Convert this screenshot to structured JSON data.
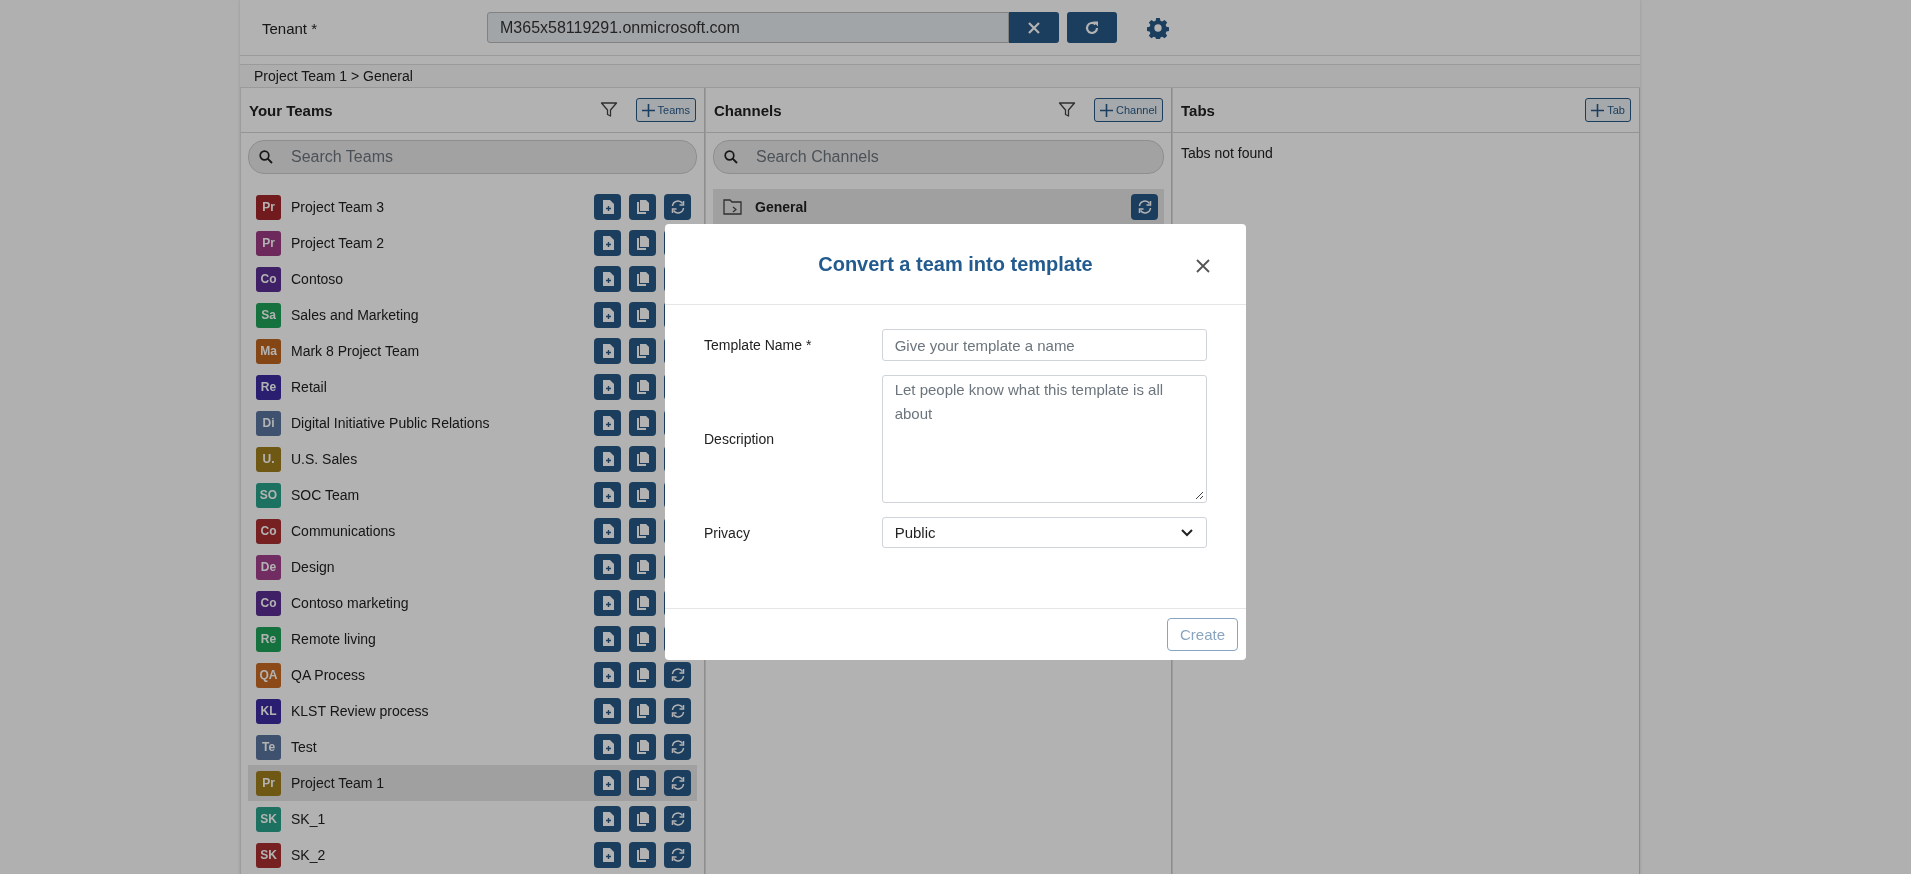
{
  "tenant": {
    "label": "Tenant *",
    "value": "M365x58119291.onmicrosoft.com"
  },
  "breadcrumb": "Project Team 1 > General",
  "teams_panel": {
    "title": "Your Teams",
    "add_button": "Teams",
    "search_placeholder": "Search Teams",
    "items": [
      {
        "initials": "Pr",
        "name": "Project Team 3",
        "color": "#731b1f",
        "selected": false
      },
      {
        "initials": "Pr",
        "name": "Project Team 2",
        "color": "#6d295c",
        "selected": false
      },
      {
        "initials": "Co",
        "name": "Contoso",
        "color": "#402066",
        "selected": false
      },
      {
        "initials": "Sa",
        "name": "Sales and Marketing",
        "color": "#16723f",
        "selected": false
      },
      {
        "initials": "Ma",
        "name": "Mark 8 Project Team",
        "color": "#864716",
        "selected": false
      },
      {
        "initials": "Re",
        "name": "Retail",
        "color": "#291f6f",
        "selected": false
      },
      {
        "initials": "Di",
        "name": "Digital Initiative Public Relations",
        "color": "#3e516f",
        "selected": false
      },
      {
        "initials": "U.",
        "name": "U.S. Sales",
        "color": "#705814",
        "selected": false
      },
      {
        "initials": "SO",
        "name": "SOC Team",
        "color": "#1d7261",
        "selected": false
      },
      {
        "initials": "Co",
        "name": "Communications",
        "color": "#762123",
        "selected": false
      },
      {
        "initials": "De",
        "name": "Design",
        "color": "#722d63",
        "selected": false
      },
      {
        "initials": "Co",
        "name": "Contoso marketing",
        "color": "#402066",
        "selected": false
      },
      {
        "initials": "Re",
        "name": "Remote living",
        "color": "#16723f",
        "selected": false
      },
      {
        "initials": "QA",
        "name": "QA Process",
        "color": "#8b4a18",
        "selected": false
      },
      {
        "initials": "KL",
        "name": "KLST Review process",
        "color": "#291f6f",
        "selected": false
      },
      {
        "initials": "Te",
        "name": "Test",
        "color": "#3e516f",
        "selected": false
      },
      {
        "initials": "Pr",
        "name": "Project Team 1",
        "color": "#705814",
        "selected": true
      },
      {
        "initials": "SK",
        "name": "SK_1",
        "color": "#1d7261",
        "selected": false
      },
      {
        "initials": "SK",
        "name": "SK_2",
        "color": "#762123",
        "selected": false
      }
    ]
  },
  "channels_panel": {
    "title": "Channels",
    "add_button": "Channel",
    "search_placeholder": "Search Channels",
    "items": [
      {
        "name": "General",
        "selected": true
      }
    ]
  },
  "tabs_panel": {
    "title": "Tabs",
    "add_button": "Tab",
    "empty_text": "Tabs not found"
  },
  "dialog": {
    "title": "Convert a team into template",
    "fields": [
      {
        "kind": "text",
        "label": "Template Name *",
        "placeholder": "Give your template a name"
      },
      {
        "kind": "textarea",
        "label": "Description",
        "placeholder": "Let people know what this template is all about"
      },
      {
        "kind": "select",
        "label": "Privacy",
        "value": "Public"
      }
    ],
    "submit_button": {
      "label": "Create",
      "disabled": true
    }
  }
}
